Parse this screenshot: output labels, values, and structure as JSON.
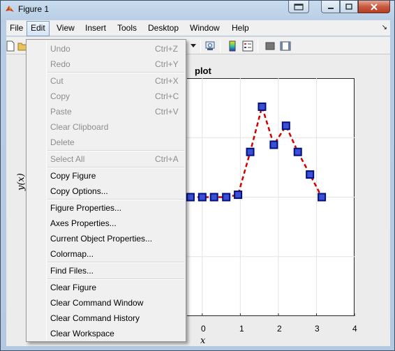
{
  "window": {
    "title": "Figure 1"
  },
  "menubar": {
    "items": [
      {
        "label": "File"
      },
      {
        "label": "Edit"
      },
      {
        "label": "View"
      },
      {
        "label": "Insert"
      },
      {
        "label": "Tools"
      },
      {
        "label": "Desktop"
      },
      {
        "label": "Window"
      },
      {
        "label": "Help"
      }
    ]
  },
  "toolbar": {
    "icons": [
      "new-figure-icon",
      "open-file-icon",
      "dropdown-arrow-icon",
      "link-plot-icon",
      "colorbar-icon",
      "legend-icon",
      "hide-plot-tools-icon",
      "show-plot-tools-icon"
    ]
  },
  "edit_menu": {
    "groups": [
      [
        {
          "label": "Undo",
          "shortcut": "Ctrl+Z",
          "enabled": false
        },
        {
          "label": "Redo",
          "shortcut": "Ctrl+Y",
          "enabled": false
        }
      ],
      [
        {
          "label": "Cut",
          "shortcut": "Ctrl+X",
          "enabled": false
        },
        {
          "label": "Copy",
          "shortcut": "Ctrl+C",
          "enabled": false
        },
        {
          "label": "Paste",
          "shortcut": "Ctrl+V",
          "enabled": false
        },
        {
          "label": "Clear Clipboard",
          "shortcut": "",
          "enabled": false
        },
        {
          "label": "Delete",
          "shortcut": "",
          "enabled": false
        }
      ],
      [
        {
          "label": "Select All",
          "shortcut": "Ctrl+A",
          "enabled": false
        }
      ],
      [
        {
          "label": "Copy Figure",
          "shortcut": "",
          "enabled": true
        },
        {
          "label": "Copy Options...",
          "shortcut": "",
          "enabled": true
        }
      ],
      [
        {
          "label": "Figure Properties...",
          "shortcut": "",
          "enabled": true
        },
        {
          "label": "Axes Properties...",
          "shortcut": "",
          "enabled": true
        },
        {
          "label": "Current Object Properties...",
          "shortcut": "",
          "enabled": true
        },
        {
          "label": "Colormap...",
          "shortcut": "",
          "enabled": true
        }
      ],
      [
        {
          "label": "Find Files...",
          "shortcut": "",
          "enabled": true
        }
      ],
      [
        {
          "label": "Clear Figure",
          "shortcut": "",
          "enabled": true
        },
        {
          "label": "Clear Command Window",
          "shortcut": "",
          "enabled": true
        },
        {
          "label": "Clear Command History",
          "shortcut": "",
          "enabled": true
        },
        {
          "label": "Clear Workspace",
          "shortcut": "",
          "enabled": true
        }
      ]
    ]
  },
  "plot": {
    "title": "plot",
    "xlabel": "x",
    "ylabel": "y(x)",
    "x_ticks": [
      "0",
      "1",
      "2",
      "3",
      "4"
    ],
    "line_color": "#d40000",
    "marker_face": "#3a4fd4",
    "marker_edge": "#001080"
  },
  "chart_data": {
    "type": "line",
    "title": "plot",
    "xlabel": "x",
    "ylabel": "y(x)",
    "xlim": [
      -0.4,
      4
    ],
    "ylim": [
      -1,
      1
    ],
    "grid": true,
    "x": [
      -0.31,
      0.0,
      0.31,
      0.63,
      0.94,
      1.26,
      1.57,
      1.88,
      2.2,
      2.51,
      2.83,
      3.14
    ],
    "y": [
      0.0,
      0.0,
      0.0,
      0.0,
      0.02,
      0.38,
      0.76,
      0.44,
      0.6,
      0.38,
      0.19,
      0.0
    ]
  }
}
